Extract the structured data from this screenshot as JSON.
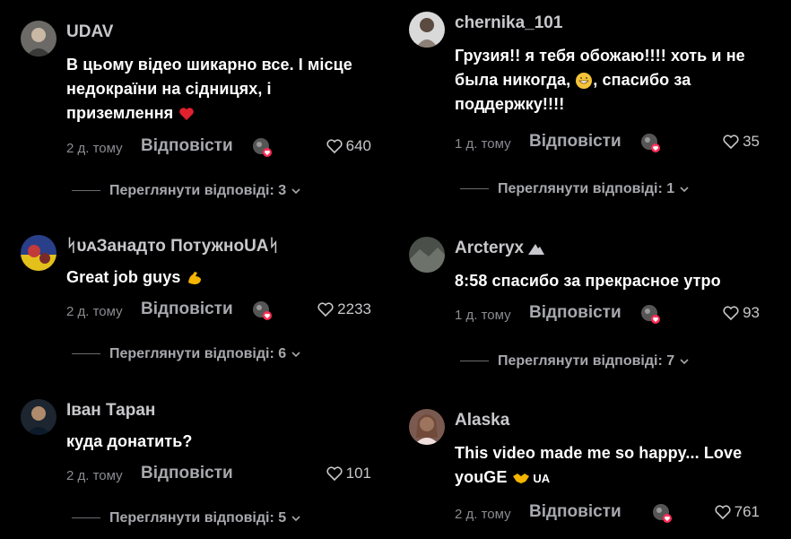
{
  "columns": [
    {
      "comments": [
        {
          "username": "UDAV",
          "text": "В цьому відео шикарно все. І місце\nнедокраїни на сідницях, і\nприземлення",
          "emoji": "heart",
          "time": "2 д. тому",
          "reply_label": "Відповісти",
          "likes": "640",
          "thread_label": "Переглянути відповіді: 3"
        },
        {
          "username": "ᛋᴜᴀЗанадто ПотужноUAᛋ",
          "text": "Great job guys",
          "emoji": "flex",
          "time": "2 д. тому",
          "reply_label": "Відповісти",
          "likes": "2233",
          "thread_label": "Переглянути відповіді: 6"
        },
        {
          "username": "Іван Таран",
          "text": "куда донатить?",
          "time": "2 д. тому",
          "reply_label": "Відповісти",
          "likes": "101",
          "thread_label": "Переглянути відповіді: 5"
        }
      ]
    },
    {
      "comments": [
        {
          "username": "chernika_101",
          "text_parts": [
            "Грузия!! я тебя обожаю!!!! хоть и не\nбыла никогда, ",
            ", спасибо за\nподдержку!!!!"
          ],
          "time": "1 д. тому",
          "reply_label": "Відповісти",
          "likes": "35",
          "thread_label": "Переглянути відповіді: 1"
        },
        {
          "username": "Arcteryx",
          "text": "8:58 спасибо за прекрасное утро",
          "time": "1 д. тому",
          "reply_label": "Відповісти",
          "likes": "93",
          "thread_label": "Переглянути відповіді: 7"
        },
        {
          "username": "Alaska",
          "text_parts": [
            "This video made me so happy... Love\nyouGE ",
            " UA"
          ],
          "time": "2 д. тому",
          "reply_label": "Відповісти",
          "likes": "761"
        }
      ]
    }
  ],
  "colors": {
    "background": "#000000",
    "username": "#c8c8cc",
    "muted": "#8a8b91",
    "heart_badge": "#fe2c55"
  }
}
